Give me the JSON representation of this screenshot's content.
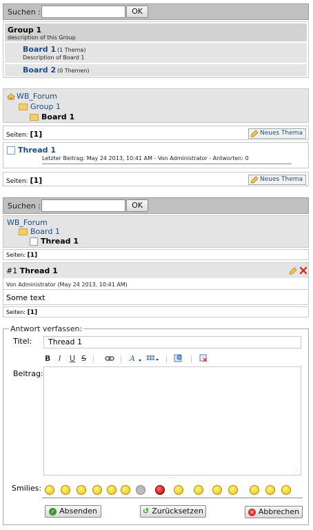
{
  "search1": {
    "label": "Suchen :",
    "button": "OK",
    "value": ""
  },
  "group": {
    "title": "Group 1",
    "description": "description of this Group",
    "boards": [
      {
        "name": "Board 1",
        "count": "(1 Thema)",
        "description": "Description of Board 1"
      },
      {
        "name": "Board 2",
        "count": "(0 Themen)"
      }
    ]
  },
  "breadcrumb1": {
    "root": "WB_Forum",
    "group": "Group 1",
    "board": "Board 1"
  },
  "pager1": {
    "label": "Seiten:",
    "current": "[1]",
    "new_topic": "Neues Thema"
  },
  "thread_list": {
    "title": "Thread 1",
    "last_post": "Letzter Beitrag: May 24 2013, 10:41 AM - Von Administrator - Antworten: 0"
  },
  "pager2": {
    "label": "Seiten:",
    "current": "[1]",
    "new_topic": "Neues Thema"
  },
  "search2": {
    "label": "Suchen :",
    "button": "OK",
    "value": ""
  },
  "breadcrumb2": {
    "root": "WB_Forum",
    "group": "Board 1",
    "thread": "Thread 1"
  },
  "pager3": {
    "label": "Seiten:",
    "current": "[1]"
  },
  "post": {
    "number": "#1",
    "title": "Thread 1",
    "meta": "Von Administrator (May 24 2013, 10:41 AM)",
    "body": "Some text"
  },
  "pager4": {
    "label": "Seiten:",
    "current": "[1]"
  },
  "reply": {
    "legend": "Antwort verfassen:",
    "title_label": "Titel:",
    "title_value": "Thread 1",
    "body_label": "Beitrag:",
    "body_value": "",
    "smilies_label": "Smilies:",
    "toolbar": [
      "B",
      "I",
      "U",
      "S"
    ],
    "buttons": {
      "send": "Absenden",
      "reset": "Zurücksetzen",
      "cancel": "Abbrechen"
    }
  },
  "colors": {
    "link": "#1a4c86",
    "header_bg": "#c0c0c0",
    "panel_bg": "#e4e4e4",
    "cancel": "#d9312b",
    "send": "#3a9a2a"
  }
}
